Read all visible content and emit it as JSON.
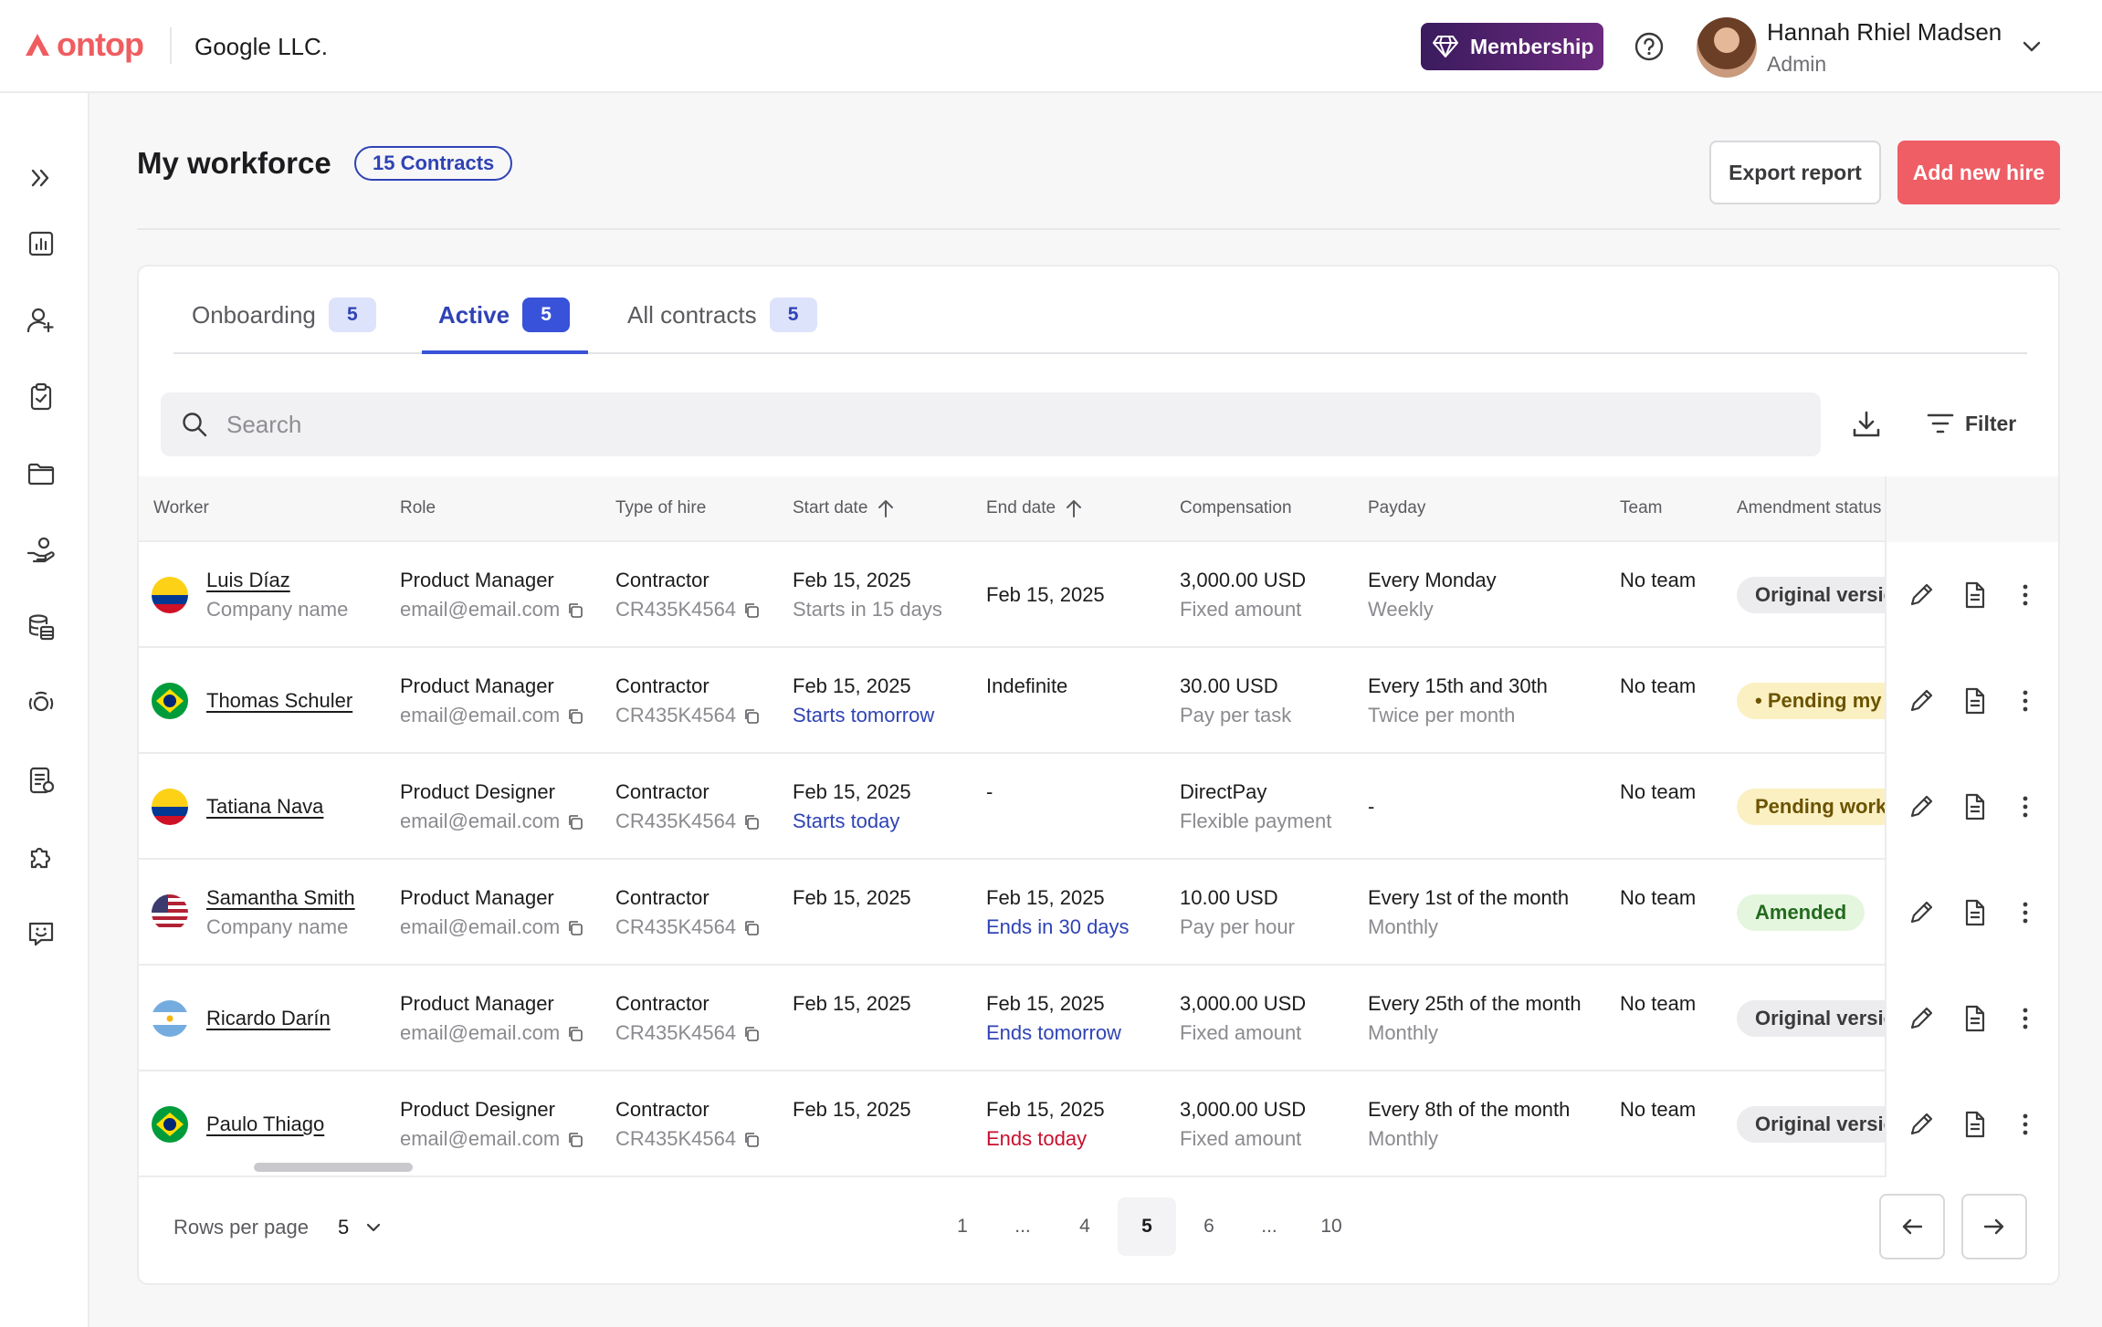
{
  "header": {
    "logo_text": "ontop",
    "company": "Google LLC.",
    "membership_label": "Membership",
    "user_name": "Hannah Rhiel Madsen",
    "user_role": "Admin"
  },
  "sidebar": {
    "items": [
      "expand-icon",
      "analytics-icon",
      "add-user-icon",
      "clipboard-check-icon",
      "folder-icon",
      "hand-coins-icon",
      "database-coins-icon",
      "support-icon",
      "document-list-icon",
      "puzzle-icon",
      "chat-smile-icon"
    ]
  },
  "page": {
    "title": "My workforce",
    "contracts_pill": "15 Contracts",
    "export_label": "Export report",
    "add_label": "Add new hire"
  },
  "tabs": [
    {
      "label": "Onboarding",
      "count": "5"
    },
    {
      "label": "Active",
      "count": "5"
    },
    {
      "label": "All contracts",
      "count": "5"
    }
  ],
  "search": {
    "placeholder": "Search"
  },
  "filter_label": "Filter",
  "columns": {
    "worker": "Worker",
    "role": "Role",
    "type": "Type of hire",
    "start": "Start date",
    "end": "End date",
    "comp": "Compensation",
    "payday": "Payday",
    "team": "Team",
    "amend": "Amendment status"
  },
  "rows": [
    {
      "flag": "colombia",
      "name": "Luis Díaz",
      "company": "Company name",
      "role": "Product Manager",
      "email": "email@email.com",
      "type": "Contractor",
      "code": "CR435K4564",
      "start": "Feb 15, 2025",
      "start_note": "Starts in 15 days",
      "start_note_style": "grey",
      "end": "Feb 15, 2025",
      "end_note": "",
      "end_note_style": "",
      "comp": "3,000.00 USD",
      "comp_note": "Fixed amount",
      "payday": "Every Monday",
      "payday_note": "Weekly",
      "team": "No team",
      "amend": "Original version",
      "amend_style": "grey"
    },
    {
      "flag": "brazil",
      "name": "Thomas Schuler",
      "company": "",
      "role": "Product Manager",
      "email": "email@email.com",
      "type": "Contractor",
      "code": "CR435K4564",
      "start": "Feb 15, 2025",
      "start_note": "Starts tomorrow",
      "start_note_style": "blue",
      "end": "Indefinite",
      "end_note": "",
      "end_note_style": "",
      "comp": "30.00 USD",
      "comp_note": "Pay per task",
      "payday": "Every 15th and 30th",
      "payday_note": "Twice per month",
      "team": "No team",
      "amend": "• Pending my review",
      "amend_style": "yellow"
    },
    {
      "flag": "colombia",
      "name": "Tatiana Nava",
      "company": "",
      "role": "Product Designer",
      "email": "email@email.com",
      "type": "Contractor",
      "code": "CR435K4564",
      "start": "Feb 15, 2025",
      "start_note": "Starts today",
      "start_note_style": "blue",
      "end": "-",
      "end_note": "",
      "end_note_style": "",
      "comp": "DirectPay",
      "comp_note": "Flexible payment",
      "payday": "-",
      "payday_note": "",
      "team": "No team",
      "amend": "Pending worker review",
      "amend_style": "yellow"
    },
    {
      "flag": "usa",
      "name": "Samantha Smith",
      "company": "Company name",
      "role": "Product Manager",
      "email": "email@email.com",
      "type": "Contractor",
      "code": "CR435K4564",
      "start": "Feb 15, 2025",
      "start_note": "",
      "start_note_style": "",
      "end": "Feb 15, 2025",
      "end_note": "Ends in 30 days",
      "end_note_style": "blue",
      "comp": "10.00 USD",
      "comp_note": "Pay per hour",
      "payday": "Every 1st of the month",
      "payday_note": "Monthly",
      "team": "No team",
      "amend": "Amended",
      "amend_style": "green"
    },
    {
      "flag": "argentina",
      "name": "Ricardo Darín",
      "company": "",
      "role": "Product Manager",
      "email": "email@email.com",
      "type": "Contractor",
      "code": "CR435K4564",
      "start": "Feb 15, 2025",
      "start_note": "",
      "start_note_style": "",
      "end": "Feb 15, 2025",
      "end_note": "Ends tomorrow",
      "end_note_style": "blue",
      "comp": "3,000.00 USD",
      "comp_note": "Fixed amount",
      "payday": "Every 25th of the month",
      "payday_note": "Monthly",
      "team": "No team",
      "amend": "Original version",
      "amend_style": "grey"
    },
    {
      "flag": "brazil",
      "name": "Paulo Thiago",
      "company": "",
      "role": "Product Designer",
      "email": "email@email.com",
      "type": "Contractor",
      "code": "CR435K4564",
      "start": "Feb 15, 2025",
      "start_note": "",
      "start_note_style": "",
      "end": "Feb 15, 2025",
      "end_note": "Ends today",
      "end_note_style": "red",
      "comp": "3,000.00 USD",
      "comp_note": "Fixed amount",
      "payday": "Every 8th of the month",
      "payday_note": "Monthly",
      "team": "No team",
      "amend": "Original version",
      "amend_style": "grey"
    }
  ],
  "pagination": {
    "rows_label": "Rows per page",
    "rows_value": "5",
    "pages": [
      "1",
      "...",
      "4",
      "5",
      "6",
      "...",
      "10"
    ],
    "current": "5"
  },
  "colors": {
    "brand": "#ef5d60",
    "accent": "#3852d9",
    "add_button": "#ef5d65"
  }
}
